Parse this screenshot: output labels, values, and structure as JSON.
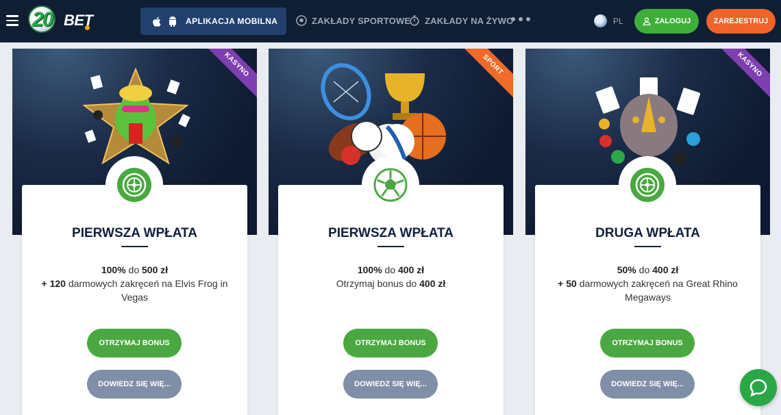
{
  "header": {
    "logo": "20BET",
    "app_button": "APLIKACJA MOBILNA",
    "nav": [
      {
        "label": "ZAKŁADY SPORTOWE",
        "icon": "soccer-ball-icon"
      },
      {
        "label": "ZAKŁADY NA ŻYWO",
        "icon": "stopwatch-icon"
      }
    ],
    "more_icon": "more-dots-icon",
    "language": "PL",
    "login": "ZALOGUJ",
    "register": "ZAREJESTRUJ"
  },
  "cards": [
    {
      "ribbon": "KASYNO",
      "ribbon_color": "#7e3fb1",
      "title": "PIERWSZA WPŁATA",
      "line1_strong": "100%",
      "line1_mid": " do ",
      "line1_end": "500 zł",
      "line2_strong": "+ 120",
      "line2_rest": " darmowych zakręceń na Elvis Frog in Vegas",
      "bonus_button": "OTRZYMAJ BONUS",
      "more_button": "DOWIEDZ SIĘ WIĘ..."
    },
    {
      "ribbon": "SPORT",
      "ribbon_color": "#f06a2a",
      "title": "PIERWSZA WPŁATA",
      "line1_strong": "100%",
      "line1_mid": " do ",
      "line1_end": "400 zł",
      "line2_pre": "Otrzymaj bonus do ",
      "line2_strong": "400 zł",
      "bonus_button": "OTRZYMAJ BONUS",
      "more_button": "DOWIEDZ SIĘ WIĘ..."
    },
    {
      "ribbon": "KASYNO",
      "ribbon_color": "#7e3fb1",
      "title": "DRUGA WPŁATA",
      "line1_strong": "50%",
      "line1_mid": " do ",
      "line1_end": "400 zł",
      "line2_strong": "+ 50",
      "line2_rest": " darmowych zakręceń na Great Rhino Megaways",
      "bonus_button": "OTRZYMAJ BONUS",
      "more_button": "DOWIEDZ SIĘ WIĘ..."
    }
  ],
  "colors": {
    "accent_green": "#4aa840",
    "register_orange": "#f0632a",
    "header_bg": "#0f1e33"
  }
}
